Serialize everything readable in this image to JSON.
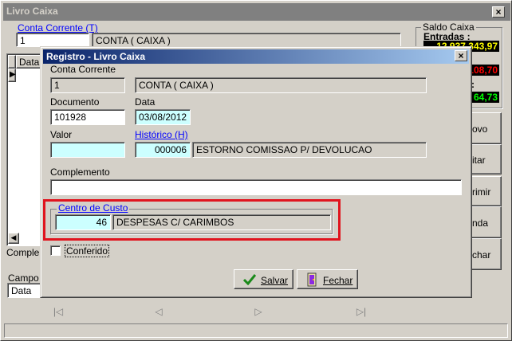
{
  "main_window": {
    "title": "Livro Caixa",
    "conta_corrente_label": "Conta Corrente (T)",
    "conta_corrente_code": "1",
    "conta_corrente_name": "CONTA ( CAIXA )",
    "grid_header_data": "Data",
    "complemento_label": "Complem",
    "campo_label": "Campo S",
    "campo_value": "Data",
    "saldo_caixa_label": "Saldo Caixa",
    "entradas_label": "Entradas :",
    "entradas_value": "12.937.343,97",
    "saidas_value": "108,70",
    "saldo_value": "64,73",
    "saldo_colon": ":",
    "side_buttons": [
      "ovo",
      "itar",
      "rimir",
      "nda",
      "char"
    ],
    "nav_buttons": [
      "|◁",
      "◁",
      "▷",
      "▷|"
    ]
  },
  "dialog": {
    "title": "Registro - Livro Caixa",
    "conta_corrente_label": "Conta Corrente",
    "conta_corrente_code": "1",
    "conta_corrente_name": "CONTA ( CAIXA )",
    "documento_label": "Documento",
    "documento_value": "101928",
    "data_label": "Data",
    "data_value": "03/08/2012",
    "valor_label": "Valor",
    "valor_value": "",
    "historico_label": "Histórico (H)",
    "historico_code": "000006",
    "historico_desc": "ESTORNO COMISSAO P/ DEVOLUCAO",
    "complemento_label": "Complemento",
    "complemento_value": "",
    "centro_custo_label": "Centro de Custo",
    "centro_custo_code": "46",
    "centro_custo_desc": "DESPESAS C/ CARIMBOS",
    "conferido_label": "Conferido",
    "salvar_label": "Salvar",
    "fechar_label": "Fechar"
  },
  "colors": {
    "highlight_border": "#e0141e",
    "entradas_color": "#ffff00",
    "saidas_color": "#ff0000",
    "saldo_color": "#00ff00"
  }
}
